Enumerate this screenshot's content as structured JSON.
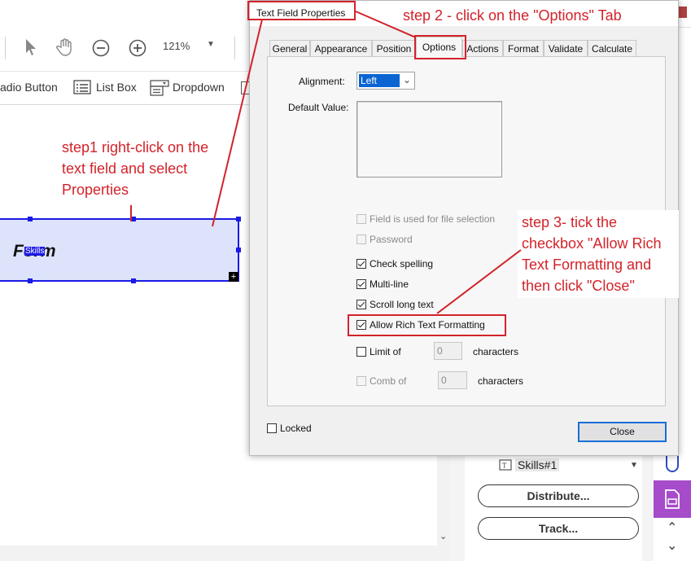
{
  "toolbar": {
    "zoom": "121%",
    "radio_button_label": "adio Button",
    "list_box_label": "List Box",
    "dropdown_label": "Dropdown"
  },
  "canvas": {
    "field_text": "Form",
    "field_tag": "Skills"
  },
  "annotations": {
    "step1_line1": "step1 right-click on the",
    "step1_line2": "text field and select",
    "step1_line3": "Properties",
    "step2": "step 2 - click on the \"Options\" Tab",
    "step3_line1": "step 3-  tick the",
    "step3_line2": "checkbox  \"Allow Rich",
    "step3_line3": "Text Formatting and",
    "step3_line4": "then click \"Close\""
  },
  "dialog": {
    "title": "Text Field Properties",
    "tabs": [
      "General",
      "Appearance",
      "Position",
      "Options",
      "Actions",
      "Format",
      "Validate",
      "Calculate"
    ],
    "active_tab": "Options",
    "alignment_label": "Alignment:",
    "alignment_value": "Left",
    "default_value_label": "Default Value:",
    "file_selection_label": "Field is used for file selection",
    "password_label": "Password",
    "check_spelling_label": "Check spelling",
    "multiline_label": "Multi-line",
    "scroll_long_text_label": "Scroll long text",
    "allow_rich_text_label": "Allow Rich Text Formatting",
    "limit_of_label": "Limit of",
    "limit_value": "0",
    "characters_label": "characters",
    "comb_of_label": "Comb of",
    "comb_value": "0",
    "locked_label": "Locked",
    "close_label": "Close"
  },
  "right_panel": {
    "field_name": "Skills#1",
    "distribute_label": "Distribute...",
    "track_label": "Track..."
  },
  "colors": {
    "annotation_red": "#d2232a",
    "field_blue": "#1a1ae6",
    "field_fill": "#dde3fb",
    "accent_purple": "#a64bc9"
  }
}
